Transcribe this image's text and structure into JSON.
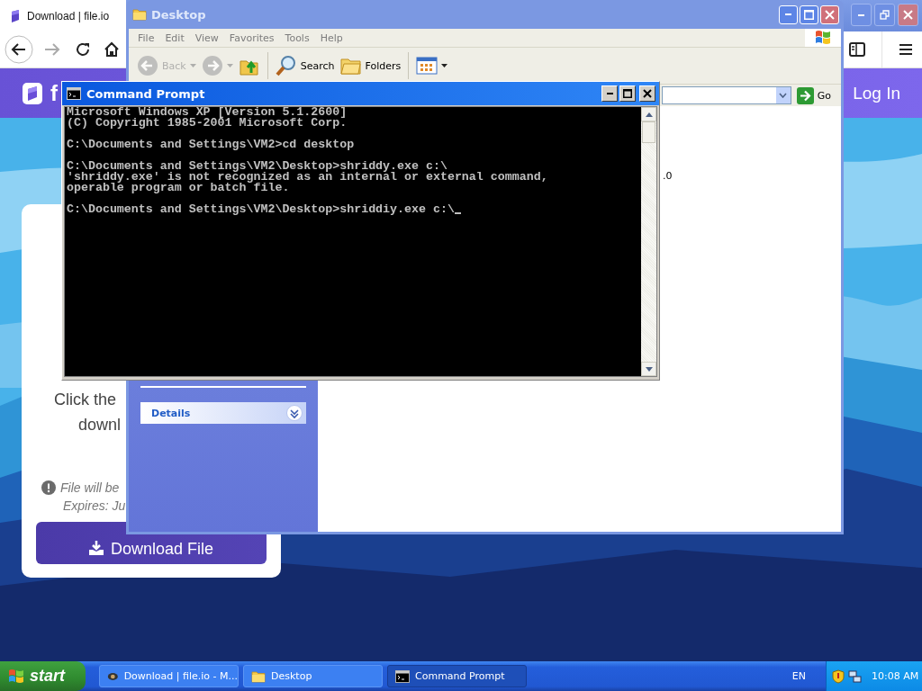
{
  "browser": {
    "tabs": [
      {
        "title": "Download | file.io",
        "selected": true
      }
    ],
    "forward": {
      "disabled": true
    },
    "site": {
      "logo_text": "f",
      "login": "Log In"
    },
    "card": {
      "message": [
        "Click the",
        "downl"
      ],
      "notice": [
        "File will be",
        "Expires: Ju"
      ],
      "button": "Download File"
    }
  },
  "explorer": {
    "title": "Desktop",
    "active": false,
    "menu": [
      "File",
      "Edit",
      "View",
      "Favorites",
      "Tools",
      "Help"
    ],
    "toolbar": [
      {
        "kind": "back",
        "label": "Back",
        "disabled": true
      },
      {
        "kind": "forward",
        "disabled": true
      },
      {
        "kind": "up",
        "disabled": false
      },
      {
        "kind": "search",
        "label": "Search",
        "disabled": false
      },
      {
        "kind": "folders",
        "label": "Folders",
        "disabled": false
      },
      {
        "kind": "views",
        "disabled": false
      }
    ],
    "go": "Go",
    "details": {
      "title": "Details",
      "expanded": false
    },
    "content_text": ".0"
  },
  "cmd": {
    "title": "Command Prompt",
    "active": true,
    "cursor": true,
    "blocks": [
      [
        "Microsoft Windows XP [Version 5.1.2600]",
        "(C) Copyright 1985-2001 Microsoft Corp."
      ],
      [
        "C:\\Documents and Settings\\VM2>cd desktop"
      ],
      [
        "C:\\Documents and Settings\\VM2\\Desktop>shriddy.exe c:\\",
        "'shriddy.exe' is not recognized as an internal or external command,",
        "operable program or batch file."
      ],
      [
        "C:\\Documents and Settings\\VM2\\Desktop>shriddiy.exe c:\\"
      ]
    ]
  },
  "taskbar": {
    "start": "start",
    "items": [
      {
        "kind": "browser",
        "label": "Download | file.io - M...",
        "selected": false
      },
      {
        "kind": "folder",
        "label": "Desktop",
        "selected": false
      },
      {
        "kind": "console",
        "label": "Command Prompt",
        "selected": true
      }
    ],
    "language": "EN",
    "clock": "10:08 AM"
  }
}
